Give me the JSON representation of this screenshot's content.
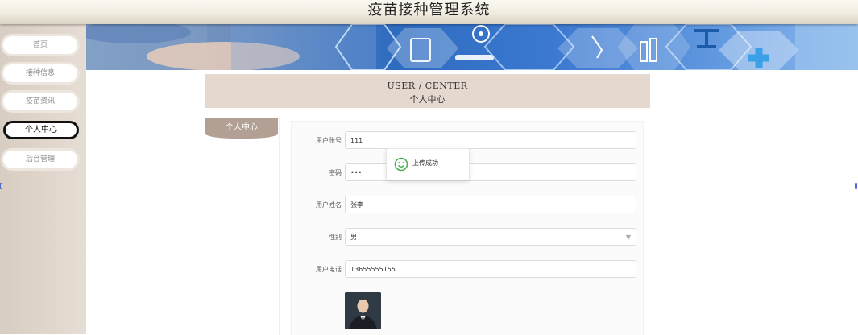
{
  "app": {
    "title": "疫苗接种管理系统"
  },
  "sidebar": {
    "items": [
      {
        "label": "首页",
        "active": false
      },
      {
        "label": "接种信息",
        "active": false
      },
      {
        "label": "疫苗资讯",
        "active": false
      },
      {
        "label": "个人中心",
        "active": true
      },
      {
        "label": "后台管理",
        "active": false
      }
    ]
  },
  "center_header": {
    "en": "USER / CENTER",
    "cn": "个人中心"
  },
  "side_tab": {
    "label": "个人中心"
  },
  "form": {
    "fields": [
      {
        "label": "用户账号",
        "value": "111"
      },
      {
        "label": "密码",
        "value": "•••"
      },
      {
        "label": "用户姓名",
        "value": "张李"
      },
      {
        "label": "性别",
        "value": "男"
      },
      {
        "label": "用户电话",
        "value": "13655555155"
      }
    ]
  },
  "toast": {
    "message": "上传成功",
    "icon": "smile-icon"
  },
  "colors": {
    "sidebar_bg": "#ddd2c7",
    "header_bg": "#e4d8cf",
    "tab_bg": "#b1a093",
    "banner_blue": "#2e6cc0",
    "toast_icon": "#4caf50"
  }
}
